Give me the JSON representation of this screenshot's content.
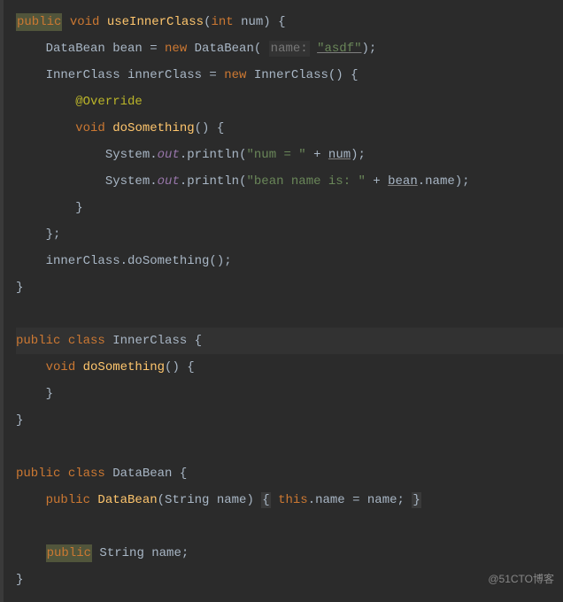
{
  "code": {
    "l1": {
      "public": "public",
      "void": " void ",
      "method": "useInnerClass",
      "lparen": "(",
      "int": "int",
      "param": " num) {"
    },
    "l2": {
      "p1": "    DataBean bean = ",
      "new": "new",
      "p2": " DataBean( ",
      "hint": "name:",
      "sp": " ",
      "str": "\"asdf\"",
      "p3": ");"
    },
    "l3": {
      "p1": "    InnerClass innerClass = ",
      "new": "new",
      "p2": " InnerClass() {"
    },
    "l4": {
      "ann": "        @Override"
    },
    "l5": {
      "p1": "        ",
      "void": "void ",
      "method": "doSomething",
      "p2": "() {"
    },
    "l6": {
      "p1": "            System.",
      "out": "out",
      "p2": ".println(",
      "str": "\"num = \"",
      "p3": " + ",
      "var": "num",
      "p4": ");"
    },
    "l7": {
      "p1": "            System.",
      "out": "out",
      "p2": ".println(",
      "str": "\"bean name is: \"",
      "p3": " + ",
      "var": "bean",
      "p4": ".name);"
    },
    "l8": {
      "p1": "        }"
    },
    "l9": {
      "p1": "    };"
    },
    "l10": {
      "p1": "    innerClass.doSomething();"
    },
    "l11": {
      "p1": "}"
    },
    "l12": {
      "public": "public ",
      "class": "class ",
      "name": "InnerClass {"
    },
    "l13": {
      "p1": "    ",
      "void": "void ",
      "method": "doSomething",
      "p2": "() {"
    },
    "l14": {
      "p1": "    }"
    },
    "l15": {
      "p1": "}"
    },
    "l16": {
      "public": "public ",
      "class": "class ",
      "name": "DataBean {"
    },
    "l17": {
      "p1": "    ",
      "public": "public ",
      "ctor": "DataBean",
      "p2": "(String name) ",
      "lb": "{",
      "sp": " ",
      "this": "this",
      "p3": ".name = name; ",
      "rb": "}"
    },
    "l18": {
      "p1": "    ",
      "public": "public",
      "p2": " String name;"
    },
    "l19": {
      "p1": "}"
    }
  },
  "watermark": "@51CTO博客"
}
